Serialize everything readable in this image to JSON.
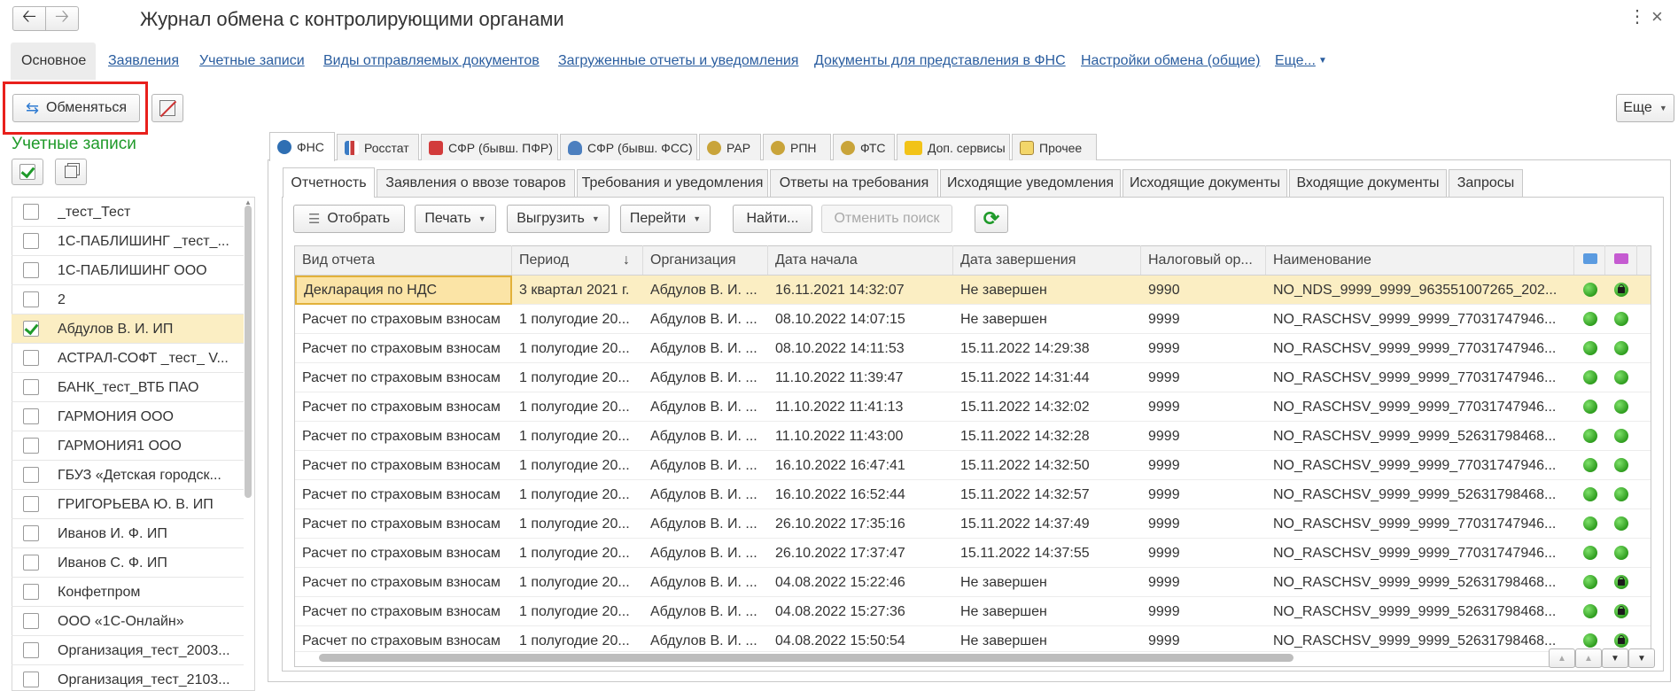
{
  "window": {
    "title": "Журнал обмена с контролирующими органами"
  },
  "nav": {
    "active_tab": "Основное",
    "links": [
      "Заявления",
      "Учетные записи",
      "Виды отправляемых документов",
      "Загруженные отчеты и уведомления",
      "Документы для представления в ФНС",
      "Настройки обмена (общие)",
      "Еще..."
    ]
  },
  "toolbar": {
    "exchange_label": "Обменяться",
    "more_label": "Еще"
  },
  "accounts": {
    "title": "Учетные записи",
    "items": [
      {
        "label": "_тест_Тест",
        "checked": false
      },
      {
        "label": "1С-ПАБЛИШИНГ _тест_...",
        "checked": false
      },
      {
        "label": "1С-ПАБЛИШИНГ ООО",
        "checked": false
      },
      {
        "label": "2",
        "checked": false
      },
      {
        "label": "Абдулов В. И. ИП",
        "checked": true
      },
      {
        "label": "АСТРАЛ-СОФТ _тест_ V...",
        "checked": false
      },
      {
        "label": "БАНК_тест_ВТБ ПАО",
        "checked": false
      },
      {
        "label": "ГАРМОНИЯ ООО",
        "checked": false
      },
      {
        "label": "ГАРМОНИЯ1 ООО",
        "checked": false
      },
      {
        "label": "ГБУЗ «Детская городск...",
        "checked": false
      },
      {
        "label": "ГРИГОРЬЕВА Ю. В. ИП",
        "checked": false
      },
      {
        "label": "Иванов И. Ф. ИП",
        "checked": false
      },
      {
        "label": "Иванов С. Ф. ИП",
        "checked": false
      },
      {
        "label": "Конфетпром",
        "checked": false
      },
      {
        "label": "ООО «1С-Онлайн»",
        "checked": false
      },
      {
        "label": "Организация_тест_2003...",
        "checked": false
      },
      {
        "label": "Организация_тест_2103...",
        "checked": false
      }
    ]
  },
  "agency_tabs": [
    "ФНС",
    "Росстат",
    "СФР (бывш. ПФР)",
    "СФР (бывш. ФСС)",
    "РАР",
    "РПН",
    "ФТС",
    "Доп. сервисы",
    "Прочее"
  ],
  "section_tabs": [
    "Отчетность",
    "Заявления о ввозе товаров",
    "Требования и уведомления",
    "Ответы на требования",
    "Исходящие уведомления",
    "Исходящие документы",
    "Входящие документы",
    "Запросы"
  ],
  "report_toolbar": {
    "filter": "Отобрать",
    "print": "Печать",
    "export": "Выгрузить",
    "goto": "Перейти",
    "find": "Найти...",
    "cancel_search": "Отменить поиск"
  },
  "table": {
    "columns": [
      "Вид отчета",
      "Период",
      "Организация",
      "Дата начала",
      "Дата завершения",
      "Налоговый ор...",
      "Наименование"
    ],
    "sort_indicator": "↓",
    "rows": [
      {
        "type": "Декларация по НДС",
        "period": "3 квартал 2021 г.",
        "org": "Абдулов В. И. ...",
        "start": "16.11.2021 14:32:07",
        "end": "Не завершен",
        "tax": "9990",
        "name": "NO_NDS_9999_9999_963551007265_202...",
        "lock": true
      },
      {
        "type": "Расчет по страховым взносам",
        "period": "1 полугодие 20...",
        "org": "Абдулов В. И. ...",
        "start": "08.10.2022 14:07:15",
        "end": "Не завершен",
        "tax": "9999",
        "name": "NO_RASCHSV_9999_9999_77031747946...",
        "lock": false
      },
      {
        "type": "Расчет по страховым взносам",
        "period": "1 полугодие 20...",
        "org": "Абдулов В. И. ...",
        "start": "08.10.2022 14:11:53",
        "end": "15.11.2022 14:29:38",
        "tax": "9999",
        "name": "NO_RASCHSV_9999_9999_77031747946...",
        "lock": false
      },
      {
        "type": "Расчет по страховым взносам",
        "period": "1 полугодие 20...",
        "org": "Абдулов В. И. ...",
        "start": "11.10.2022 11:39:47",
        "end": "15.11.2022 14:31:44",
        "tax": "9999",
        "name": "NO_RASCHSV_9999_9999_77031747946...",
        "lock": false
      },
      {
        "type": "Расчет по страховым взносам",
        "period": "1 полугодие 20...",
        "org": "Абдулов В. И. ...",
        "start": "11.10.2022 11:41:13",
        "end": "15.11.2022 14:32:02",
        "tax": "9999",
        "name": "NO_RASCHSV_9999_9999_77031747946...",
        "lock": false
      },
      {
        "type": "Расчет по страховым взносам",
        "period": "1 полугодие 20...",
        "org": "Абдулов В. И. ...",
        "start": "11.10.2022 11:43:00",
        "end": "15.11.2022 14:32:28",
        "tax": "9999",
        "name": "NO_RASCHSV_9999_9999_52631798468...",
        "lock": false
      },
      {
        "type": "Расчет по страховым взносам",
        "period": "1 полугодие 20...",
        "org": "Абдулов В. И. ...",
        "start": "16.10.2022 16:47:41",
        "end": "15.11.2022 14:32:50",
        "tax": "9999",
        "name": "NO_RASCHSV_9999_9999_77031747946...",
        "lock": false
      },
      {
        "type": "Расчет по страховым взносам",
        "period": "1 полугодие 20...",
        "org": "Абдулов В. И. ...",
        "start": "16.10.2022 16:52:44",
        "end": "15.11.2022 14:32:57",
        "tax": "9999",
        "name": "NO_RASCHSV_9999_9999_52631798468...",
        "lock": false
      },
      {
        "type": "Расчет по страховым взносам",
        "period": "1 полугодие 20...",
        "org": "Абдулов В. И. ...",
        "start": "26.10.2022 17:35:16",
        "end": "15.11.2022 14:37:49",
        "tax": "9999",
        "name": "NO_RASCHSV_9999_9999_77031747946...",
        "lock": false
      },
      {
        "type": "Расчет по страховым взносам",
        "period": "1 полугодие 20...",
        "org": "Абдулов В. И. ...",
        "start": "26.10.2022 17:37:47",
        "end": "15.11.2022 14:37:55",
        "tax": "9999",
        "name": "NO_RASCHSV_9999_9999_77031747946...",
        "lock": false
      },
      {
        "type": "Расчет по страховым взносам",
        "period": "1 полугодие 20...",
        "org": "Абдулов В. И. ...",
        "start": "04.08.2022 15:22:46",
        "end": "Не завершен",
        "tax": "9999",
        "name": "NO_RASCHSV_9999_9999_52631798468...",
        "lock": true
      },
      {
        "type": "Расчет по страховым взносам",
        "period": "1 полугодие 20...",
        "org": "Абдулов В. И. ...",
        "start": "04.08.2022 15:27:36",
        "end": "Не завершен",
        "tax": "9999",
        "name": "NO_RASCHSV_9999_9999_52631798468...",
        "lock": true
      },
      {
        "type": "Расчет по страховым взносам",
        "period": "1 полугодие 20...",
        "org": "Абдулов В. И. ...",
        "start": "04.08.2022 15:50:54",
        "end": "Не завершен",
        "tax": "9999",
        "name": "NO_RASCHSV_9999_9999_52631798468...",
        "lock": true
      }
    ]
  },
  "colors": {
    "link": "#2a5d9f",
    "accent_green": "#1f9a2a",
    "selected_row": "#fbeec3",
    "highlight_border": "#e8201c"
  }
}
